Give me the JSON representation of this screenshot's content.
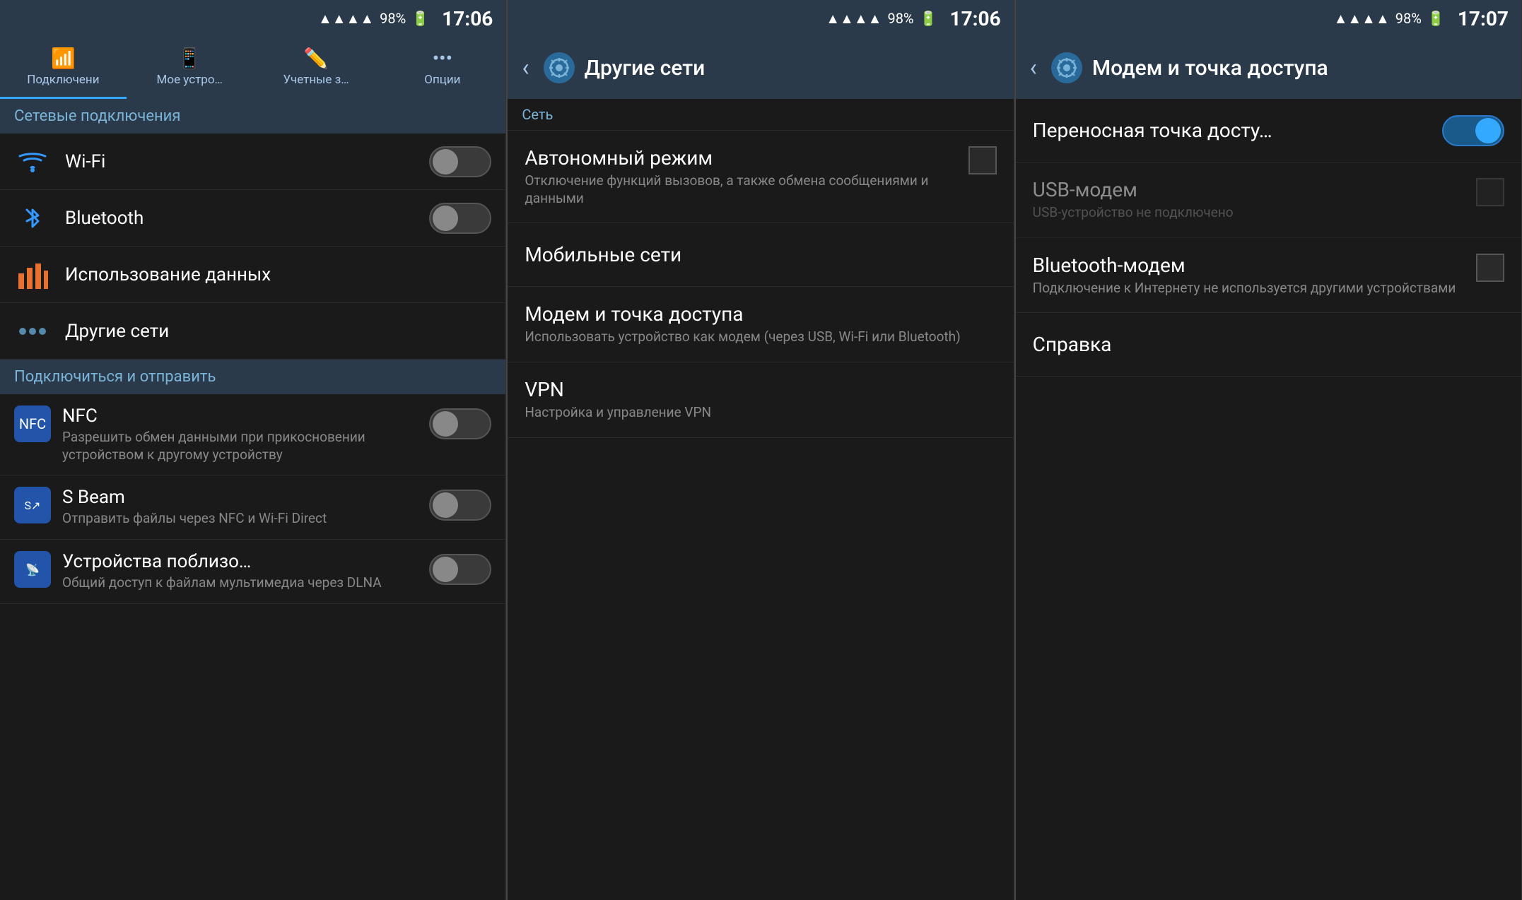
{
  "panel1": {
    "status": {
      "battery": "98%",
      "time": "17:06"
    },
    "tabs": [
      {
        "label": "Подключени",
        "icon": "📶",
        "active": true
      },
      {
        "label": "Мое устро…",
        "icon": "📱",
        "active": false
      },
      {
        "label": "Учетные з…",
        "icon": "✏️",
        "active": false
      },
      {
        "label": "Опции",
        "icon": "⋯",
        "active": false
      }
    ],
    "section_network": "Сетевые подключения",
    "items_network": [
      {
        "title": "Wi-Fi",
        "icon": "wifi",
        "toggle": true,
        "toggleOn": false
      },
      {
        "title": "Bluetooth",
        "icon": "bt",
        "toggle": true,
        "toggleOn": false
      }
    ],
    "items_other": [
      {
        "title": "Использование данных",
        "icon": "data",
        "toggle": false
      },
      {
        "title": "Другие сети",
        "icon": "more",
        "toggle": false
      }
    ],
    "section_connect": "Подключиться и отправить",
    "items_connect": [
      {
        "title": "NFC",
        "subtitle": "Разрешить обмен данными при прикосновении устройством к другому устройству",
        "icon": "nfc",
        "toggle": true,
        "toggleOn": false
      },
      {
        "title": "S Beam",
        "subtitle": "Отправить файлы через NFC и Wi-Fi Direct",
        "icon": "sbeam",
        "toggle": true,
        "toggleOn": false
      },
      {
        "title": "Устройства поблизо…",
        "subtitle": "Общий доступ к файлам мультимедиа через DLNA",
        "icon": "devices",
        "toggle": true,
        "toggleOn": false
      }
    ]
  },
  "panel2": {
    "status": {
      "battery": "98%",
      "time": "17:06"
    },
    "header_title": "Другие сети",
    "section_label": "Сеть",
    "items": [
      {
        "title": "Автономный режим",
        "subtitle": "Отключение функций вызовов, а также обмена сообщениями и данными",
        "has_checkbox": true
      },
      {
        "title": "Мобильные сети",
        "subtitle": "",
        "has_checkbox": false
      },
      {
        "title": "Модем и точка доступа",
        "subtitle": "Использовать устройство как модем (через USB, Wi-Fi или Bluetooth)",
        "has_checkbox": false
      },
      {
        "title": "VPN",
        "subtitle": "Настройка и управление VPN",
        "has_checkbox": false
      }
    ]
  },
  "panel3": {
    "status": {
      "battery": "98%",
      "time": "17:07"
    },
    "header_title": "Модем и точка доступа",
    "items": [
      {
        "title": "Переносная точка досту…",
        "subtitle": "",
        "has_checkbox": false,
        "has_toggle": true,
        "toggleOn": true
      },
      {
        "title": "USB-модем",
        "subtitle": "USB-устройство не подключено",
        "has_checkbox": true,
        "disabled": true,
        "has_toggle": false
      },
      {
        "title": "Bluetooth-модем",
        "subtitle": "Подключение к Интернету не используется другими устройствами",
        "has_checkbox": true,
        "disabled": false,
        "has_toggle": false
      },
      {
        "title": "Справка",
        "subtitle": "",
        "has_checkbox": false,
        "has_toggle": false
      }
    ]
  }
}
